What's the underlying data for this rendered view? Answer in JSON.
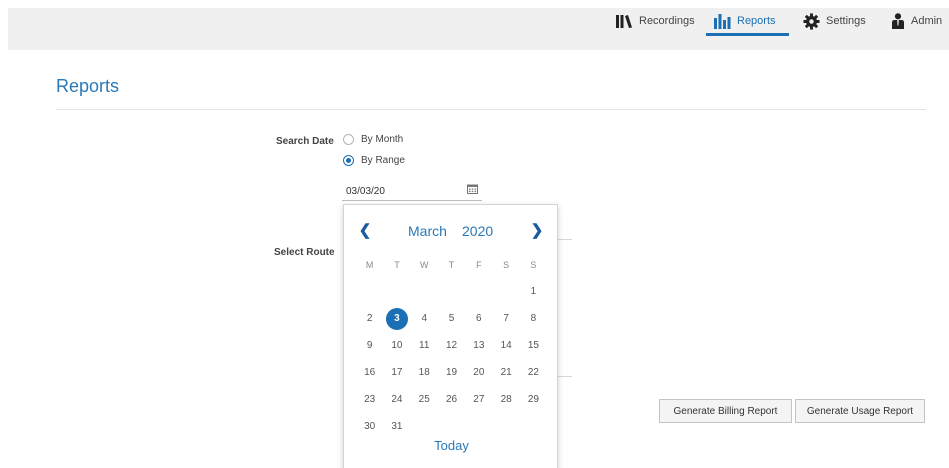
{
  "nav": {
    "recordings": "Recordings",
    "reports": "Reports",
    "settings": "Settings",
    "admin": "Admin"
  },
  "page": {
    "title": "Reports"
  },
  "form": {
    "search_date_label": "Search Date",
    "by_month": "By Month",
    "by_range": "By Range",
    "selected_mode": "By Range",
    "date_value": "03/03/20",
    "select_route_label": "Select Route"
  },
  "calendar": {
    "month": "March",
    "year": "2020",
    "weekdays": [
      "M",
      "T",
      "W",
      "T",
      "F",
      "S",
      "S"
    ],
    "weeks": [
      [
        "",
        "",
        "",
        "",
        "",
        "",
        "1"
      ],
      [
        "2",
        "3",
        "4",
        "5",
        "6",
        "7",
        "8"
      ],
      [
        "9",
        "10",
        "11",
        "12",
        "13",
        "14",
        "15"
      ],
      [
        "16",
        "17",
        "18",
        "19",
        "20",
        "21",
        "22"
      ],
      [
        "23",
        "24",
        "25",
        "26",
        "27",
        "28",
        "29"
      ],
      [
        "30",
        "31",
        "",
        "",
        "",
        "",
        ""
      ]
    ],
    "selected_day": "3",
    "today_label": "Today"
  },
  "buttons": {
    "billing": "Generate Billing Report",
    "usage": "Generate Usage Report"
  },
  "colors": {
    "accent": "#1a6fb5"
  }
}
